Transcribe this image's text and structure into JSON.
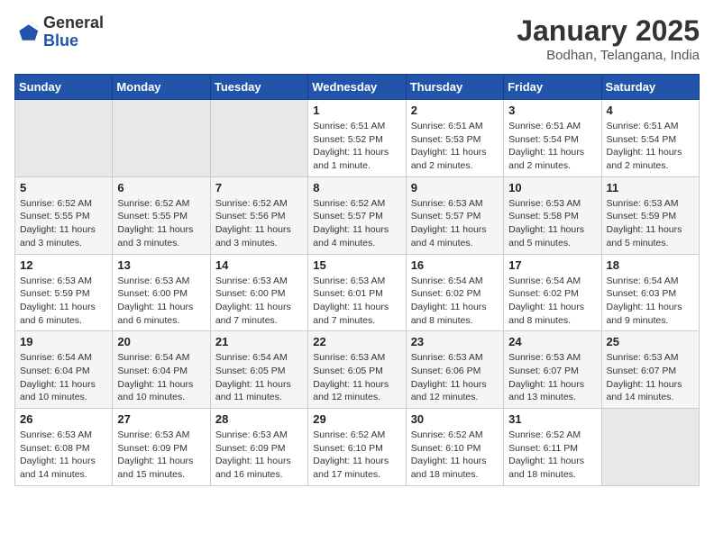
{
  "logo": {
    "general": "General",
    "blue": "Blue"
  },
  "title": "January 2025",
  "subtitle": "Bodhan, Telangana, India",
  "weekdays": [
    "Sunday",
    "Monday",
    "Tuesday",
    "Wednesday",
    "Thursday",
    "Friday",
    "Saturday"
  ],
  "weeks": [
    [
      {
        "day": "",
        "info": ""
      },
      {
        "day": "",
        "info": ""
      },
      {
        "day": "",
        "info": ""
      },
      {
        "day": "1",
        "info": "Sunrise: 6:51 AM\nSunset: 5:52 PM\nDaylight: 11 hours\nand 1 minute."
      },
      {
        "day": "2",
        "info": "Sunrise: 6:51 AM\nSunset: 5:53 PM\nDaylight: 11 hours\nand 2 minutes."
      },
      {
        "day": "3",
        "info": "Sunrise: 6:51 AM\nSunset: 5:54 PM\nDaylight: 11 hours\nand 2 minutes."
      },
      {
        "day": "4",
        "info": "Sunrise: 6:51 AM\nSunset: 5:54 PM\nDaylight: 11 hours\nand 2 minutes."
      }
    ],
    [
      {
        "day": "5",
        "info": "Sunrise: 6:52 AM\nSunset: 5:55 PM\nDaylight: 11 hours\nand 3 minutes."
      },
      {
        "day": "6",
        "info": "Sunrise: 6:52 AM\nSunset: 5:55 PM\nDaylight: 11 hours\nand 3 minutes."
      },
      {
        "day": "7",
        "info": "Sunrise: 6:52 AM\nSunset: 5:56 PM\nDaylight: 11 hours\nand 3 minutes."
      },
      {
        "day": "8",
        "info": "Sunrise: 6:52 AM\nSunset: 5:57 PM\nDaylight: 11 hours\nand 4 minutes."
      },
      {
        "day": "9",
        "info": "Sunrise: 6:53 AM\nSunset: 5:57 PM\nDaylight: 11 hours\nand 4 minutes."
      },
      {
        "day": "10",
        "info": "Sunrise: 6:53 AM\nSunset: 5:58 PM\nDaylight: 11 hours\nand 5 minutes."
      },
      {
        "day": "11",
        "info": "Sunrise: 6:53 AM\nSunset: 5:59 PM\nDaylight: 11 hours\nand 5 minutes."
      }
    ],
    [
      {
        "day": "12",
        "info": "Sunrise: 6:53 AM\nSunset: 5:59 PM\nDaylight: 11 hours\nand 6 minutes."
      },
      {
        "day": "13",
        "info": "Sunrise: 6:53 AM\nSunset: 6:00 PM\nDaylight: 11 hours\nand 6 minutes."
      },
      {
        "day": "14",
        "info": "Sunrise: 6:53 AM\nSunset: 6:00 PM\nDaylight: 11 hours\nand 7 minutes."
      },
      {
        "day": "15",
        "info": "Sunrise: 6:53 AM\nSunset: 6:01 PM\nDaylight: 11 hours\nand 7 minutes."
      },
      {
        "day": "16",
        "info": "Sunrise: 6:54 AM\nSunset: 6:02 PM\nDaylight: 11 hours\nand 8 minutes."
      },
      {
        "day": "17",
        "info": "Sunrise: 6:54 AM\nSunset: 6:02 PM\nDaylight: 11 hours\nand 8 minutes."
      },
      {
        "day": "18",
        "info": "Sunrise: 6:54 AM\nSunset: 6:03 PM\nDaylight: 11 hours\nand 9 minutes."
      }
    ],
    [
      {
        "day": "19",
        "info": "Sunrise: 6:54 AM\nSunset: 6:04 PM\nDaylight: 11 hours\nand 10 minutes."
      },
      {
        "day": "20",
        "info": "Sunrise: 6:54 AM\nSunset: 6:04 PM\nDaylight: 11 hours\nand 10 minutes."
      },
      {
        "day": "21",
        "info": "Sunrise: 6:54 AM\nSunset: 6:05 PM\nDaylight: 11 hours\nand 11 minutes."
      },
      {
        "day": "22",
        "info": "Sunrise: 6:53 AM\nSunset: 6:05 PM\nDaylight: 11 hours\nand 12 minutes."
      },
      {
        "day": "23",
        "info": "Sunrise: 6:53 AM\nSunset: 6:06 PM\nDaylight: 11 hours\nand 12 minutes."
      },
      {
        "day": "24",
        "info": "Sunrise: 6:53 AM\nSunset: 6:07 PM\nDaylight: 11 hours\nand 13 minutes."
      },
      {
        "day": "25",
        "info": "Sunrise: 6:53 AM\nSunset: 6:07 PM\nDaylight: 11 hours\nand 14 minutes."
      }
    ],
    [
      {
        "day": "26",
        "info": "Sunrise: 6:53 AM\nSunset: 6:08 PM\nDaylight: 11 hours\nand 14 minutes."
      },
      {
        "day": "27",
        "info": "Sunrise: 6:53 AM\nSunset: 6:09 PM\nDaylight: 11 hours\nand 15 minutes."
      },
      {
        "day": "28",
        "info": "Sunrise: 6:53 AM\nSunset: 6:09 PM\nDaylight: 11 hours\nand 16 minutes."
      },
      {
        "day": "29",
        "info": "Sunrise: 6:52 AM\nSunset: 6:10 PM\nDaylight: 11 hours\nand 17 minutes."
      },
      {
        "day": "30",
        "info": "Sunrise: 6:52 AM\nSunset: 6:10 PM\nDaylight: 11 hours\nand 18 minutes."
      },
      {
        "day": "31",
        "info": "Sunrise: 6:52 AM\nSunset: 6:11 PM\nDaylight: 11 hours\nand 18 minutes."
      },
      {
        "day": "",
        "info": ""
      }
    ]
  ]
}
